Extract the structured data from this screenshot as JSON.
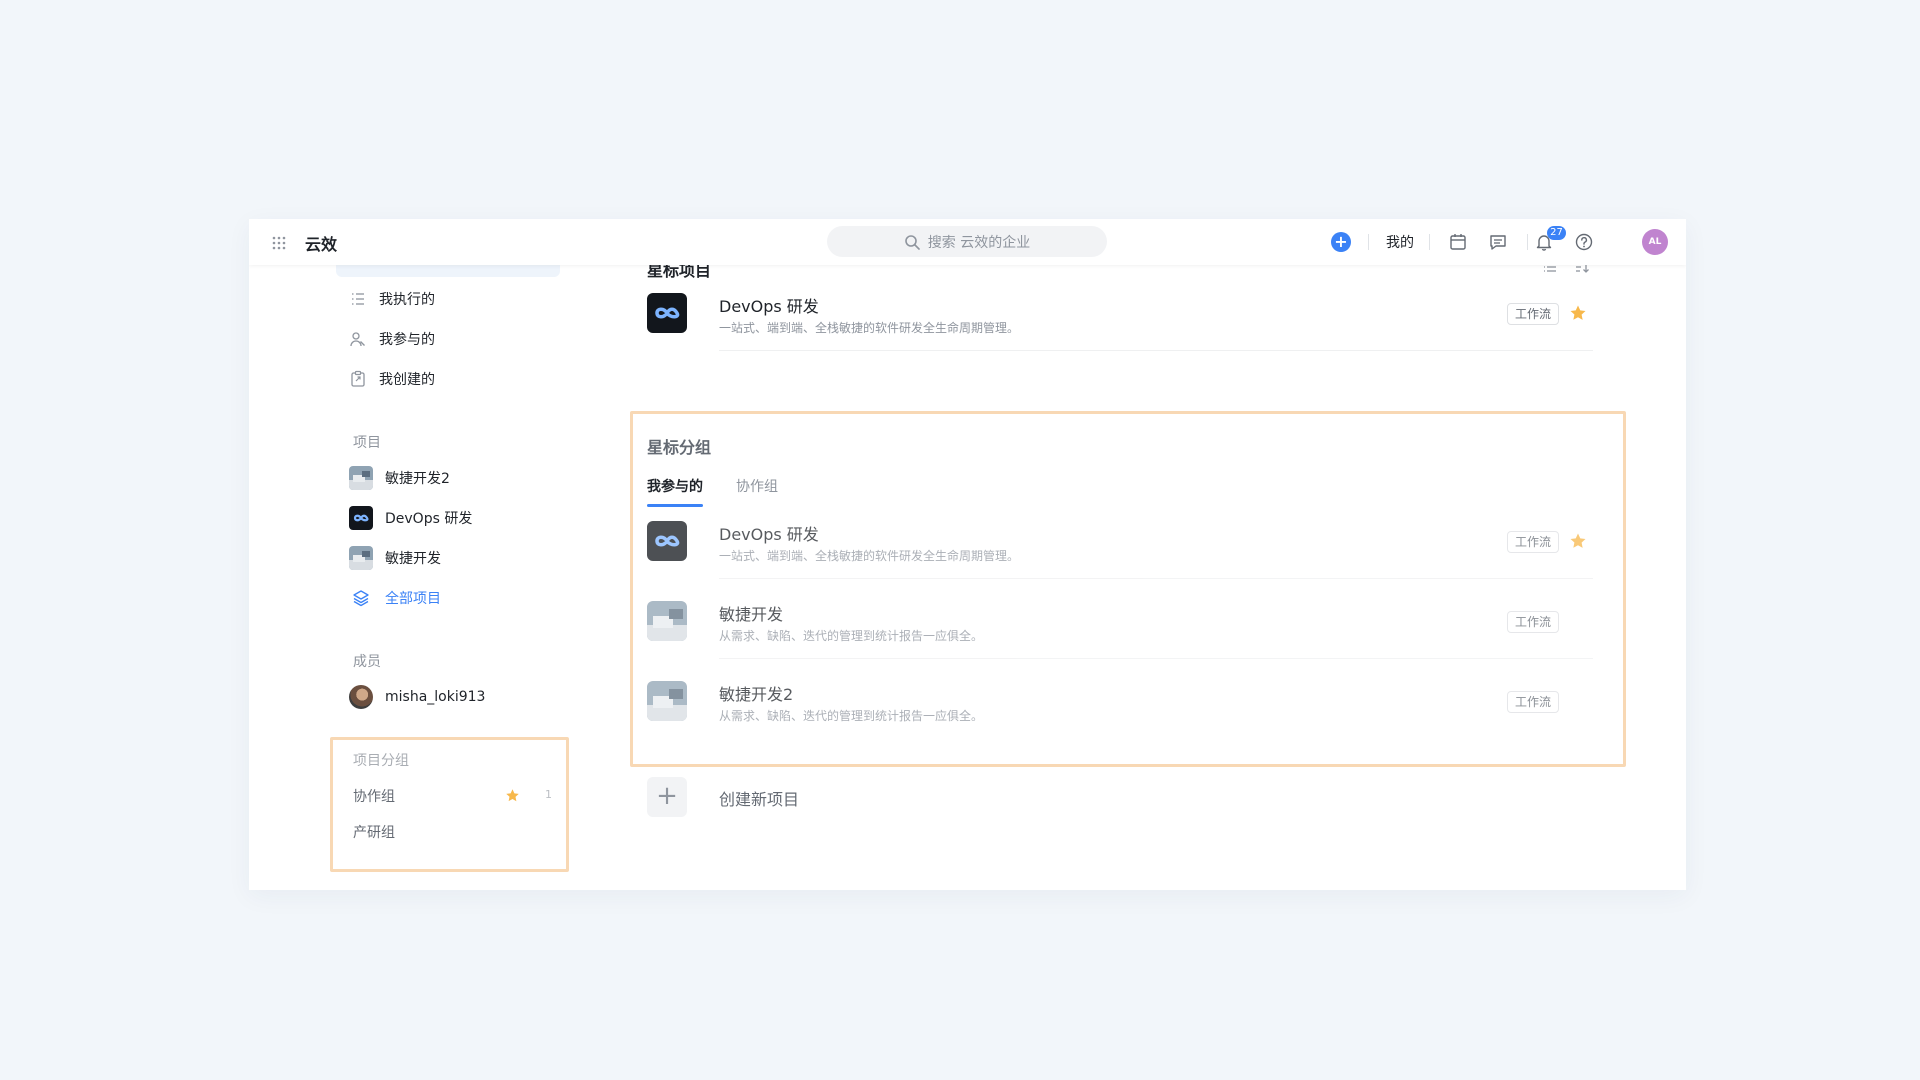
{
  "header": {
    "app_title": "云效",
    "search_placeholder": "搜索 云效的企业",
    "mine_label": "我的",
    "notification_count": "27",
    "avatar_initials": "AL",
    "icons": [
      "apps-grid-icon",
      "search-icon",
      "plus-icon",
      "calendar-icon",
      "message-icon",
      "bell-icon",
      "help-icon"
    ]
  },
  "sidebar": {
    "nav": [
      {
        "label": "我执行的",
        "icon": "list-icon"
      },
      {
        "label": "我参与的",
        "icon": "users-icon"
      },
      {
        "label": "我创建的",
        "icon": "clipboard-icon"
      }
    ],
    "projects_title": "项目",
    "projects": [
      {
        "label": "敏捷开发2",
        "icon": "project-thumb"
      },
      {
        "label": "DevOps 研发",
        "icon": "devops-logo"
      },
      {
        "label": "敏捷开发",
        "icon": "project-thumb"
      }
    ],
    "all_projects_label": "全部项目",
    "members_title": "成员",
    "members": [
      {
        "label": "misha_loki913"
      }
    ],
    "groups_title": "项目分组",
    "groups": [
      {
        "label": "协作组",
        "count": "1",
        "starred": true
      },
      {
        "label": "产研组"
      }
    ]
  },
  "main": {
    "starred_projects_title": "星标项目",
    "starred_projects": [
      {
        "name": "DevOps 研发",
        "desc": "一站式、端到端、全栈敏捷的软件研发全生命周期管理。",
        "tag": "工作流",
        "starred": true
      }
    ],
    "starred_groups_title": "星标分组",
    "tabs": [
      {
        "label": "我参与的",
        "active": true
      },
      {
        "label": "协作组",
        "active": false
      }
    ],
    "group_projects": [
      {
        "name": "DevOps 研发",
        "desc": "一站式、端到端、全栈敏捷的软件研发全生命周期管理。",
        "tag": "工作流",
        "starred": true
      },
      {
        "name": "敏捷开发",
        "desc": "从需求、缺陷、迭代的管理到统计报告一应俱全。",
        "tag": "工作流",
        "starred": false
      },
      {
        "name": "敏捷开发2",
        "desc": "从需求、缺陷、迭代的管理到统计报告一应俱全。",
        "tag": "工作流",
        "starred": false
      }
    ],
    "create_label": "创建新项目"
  },
  "colors": {
    "accent": "#3b82f6",
    "star": "#f7b84b",
    "highlight_border": "#f8d8b4",
    "page_bg": "#f2f6fa"
  }
}
